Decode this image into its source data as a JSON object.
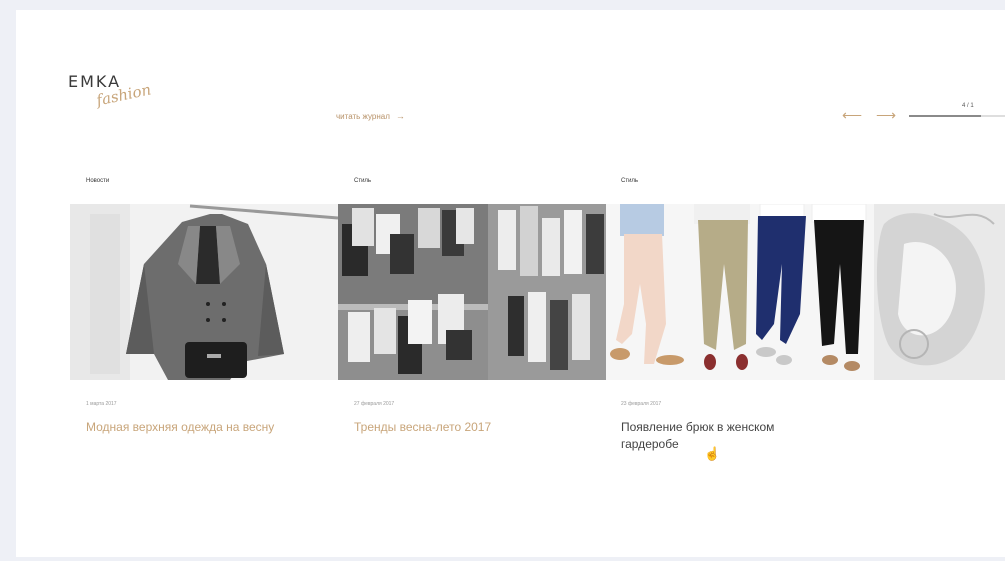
{
  "header": {
    "logo_main": "EMKA",
    "logo_script": "fashion",
    "read_all_label": "читать журнал",
    "read_all_arrow": "→",
    "prev_arrow": "⟵",
    "next_arrow": "⟶",
    "pager_label": "4 / 1",
    "pager_progress": 0.75
  },
  "articles": [
    {
      "category": "Новости",
      "date": "1 марта 2017",
      "title": "Модная верхняя одежда на весну"
    },
    {
      "category": "Стиль",
      "date": "27 февраля 2017",
      "title": "Тренды весна-лето 2017"
    },
    {
      "category": "Стиль",
      "date": "23 февраля 2017",
      "title": "Появление брюк в женском гардеробе"
    }
  ],
  "colors": {
    "accent": "#c8a57a",
    "text_dark": "#444444",
    "background": "#eef0f6"
  }
}
